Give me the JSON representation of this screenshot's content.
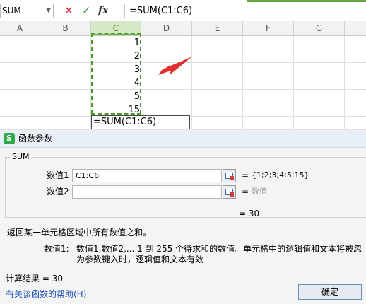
{
  "formula_bar": {
    "name_box": "SUM",
    "cancel_icon": "✕",
    "enter_icon": "✓",
    "fx": "fx",
    "formula": "=SUM(C1:C6)"
  },
  "columns": [
    "A",
    "B",
    "C",
    "D",
    "E",
    "F",
    "G"
  ],
  "selected_column": "C",
  "cells": {
    "c_values": [
      "1",
      "2",
      "3",
      "4",
      "5",
      "15"
    ],
    "active": "=SUM(C1:C6)"
  },
  "dialog": {
    "title": "函数参数",
    "app_icon": "S",
    "function_name": "SUM",
    "args": [
      {
        "label": "数值1",
        "value": "C1:C6",
        "eq": "=",
        "result": "{1;2;3;4;5;15}"
      },
      {
        "label": "数值2",
        "value": "",
        "eq": "=",
        "result": "数值"
      }
    ],
    "result_line": "=  30",
    "description": "返回某一单元格区域中所有数值之和。",
    "param_name": "数值1:",
    "param_desc_line1": "数值1,数值2,... 1 到 255 个待求和的数值。单元格中的逻辑值和文本将被忽",
    "param_desc_line2": "为参数键入时，逻辑值和文本有效",
    "calc_result": "计算结果  =  30",
    "help_link": "有关该函数的帮助(H)",
    "ok_label": "确定"
  },
  "colors": {
    "accent_green": "#4c9a2a",
    "arrow_red": "#e03131",
    "link_blue": "#1a4fb5"
  }
}
